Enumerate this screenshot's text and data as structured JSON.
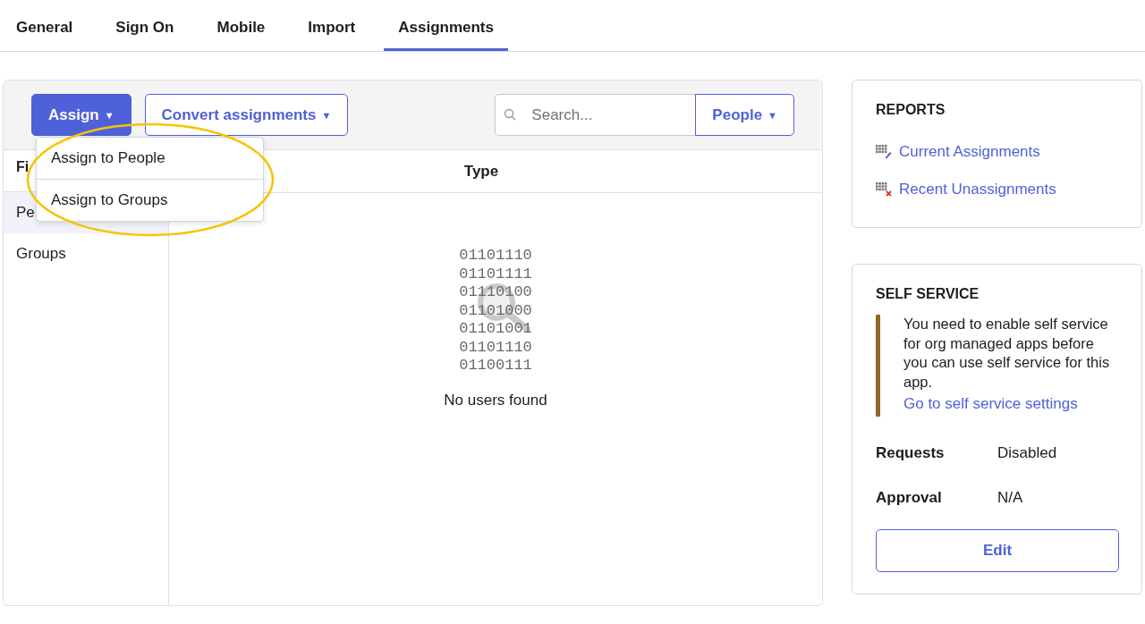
{
  "tabs": [
    {
      "label": "General",
      "selected": false
    },
    {
      "label": "Sign On",
      "selected": false
    },
    {
      "label": "Mobile",
      "selected": false
    },
    {
      "label": "Import",
      "selected": false
    },
    {
      "label": "Assignments",
      "selected": true
    }
  ],
  "toolbar": {
    "assign_button": "Assign",
    "assign_caret": "▼",
    "convert_button": "Convert assignments",
    "convert_caret": "▼",
    "search": {
      "placeholder": "Search..."
    },
    "filter_button": "People",
    "filter_caret": "▼"
  },
  "assign_menu": {
    "expanded": true,
    "items": [
      "Assign to People",
      "Assign to Groups"
    ]
  },
  "sidebar": {
    "header": "Fi",
    "items": [
      {
        "label": "Pe",
        "selected": true
      },
      {
        "label": "Groups",
        "selected": false
      }
    ]
  },
  "table": {
    "columns": [
      "Type"
    ],
    "empty_state": {
      "binary_lines": [
        "01101110",
        "01101111",
        "01110100",
        "01101000",
        "01101001",
        "01101110",
        "01100111"
      ],
      "message": "No users found"
    }
  },
  "annotation": {
    "kind": "ellipse",
    "color": "#f5c400"
  },
  "reports": {
    "title": "REPORTS",
    "links": [
      {
        "label": "Current Assignments",
        "kind": "current"
      },
      {
        "label": "Recent Unassignments",
        "kind": "removed"
      }
    ]
  },
  "self_service": {
    "title": "SELF SERVICE",
    "notice": "You need to enable self service for org managed apps before you can use self service for this app.",
    "notice_link": "Go to self service settings",
    "fields": [
      {
        "label": "Requests",
        "value": "Disabled"
      },
      {
        "label": "Approval",
        "value": "N/A"
      }
    ],
    "edit_button": "Edit"
  }
}
